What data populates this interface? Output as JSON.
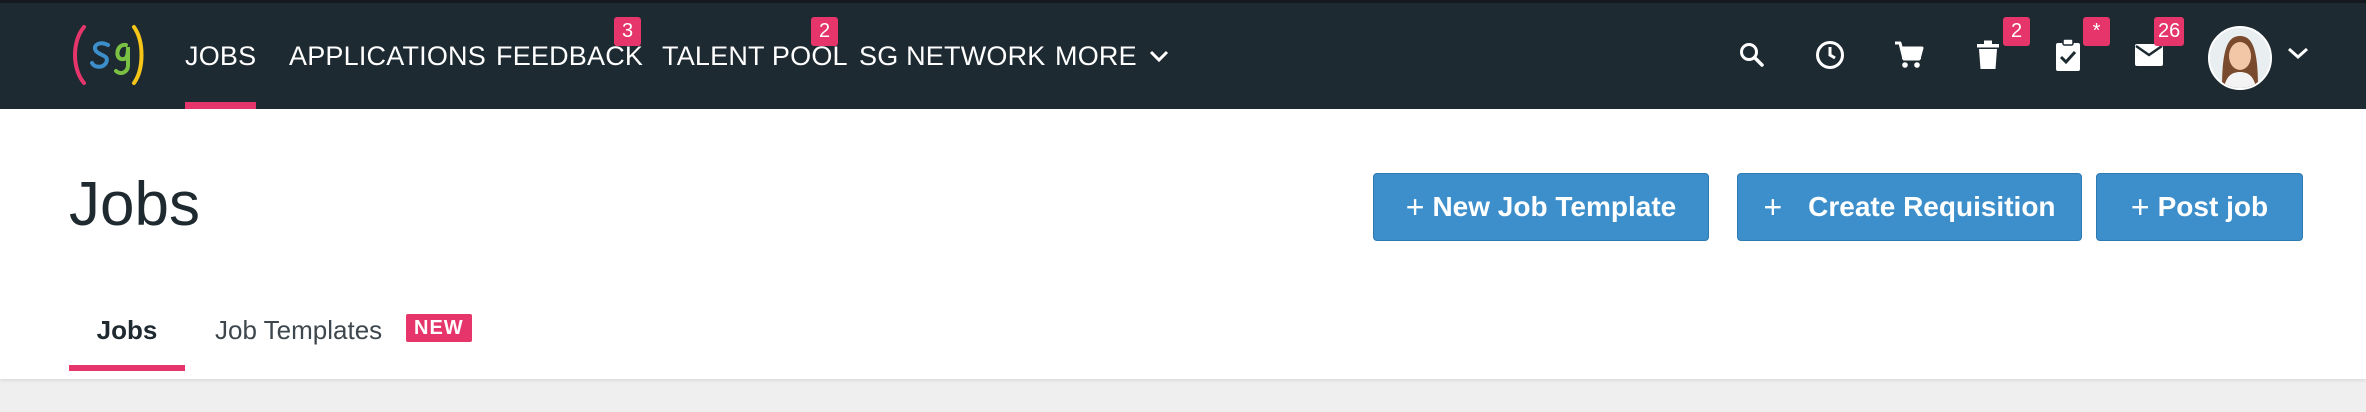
{
  "nav": {
    "items": [
      {
        "label": "JOBS"
      },
      {
        "label": "APPLICATIONS"
      },
      {
        "label": "FEEDBACK",
        "badge": "3"
      },
      {
        "label": "TALENT POOL",
        "badge": "2"
      },
      {
        "label": "SG NETWORK"
      },
      {
        "label": "MORE"
      }
    ],
    "active": "JOBS"
  },
  "toolbar": {
    "icons": [
      "search-icon",
      "history-icon",
      "cart-icon",
      "trash-icon",
      "clipboard-check-icon",
      "mail-icon"
    ],
    "trash_badge": "2",
    "tasks_badge": "*",
    "mail_badge": "26"
  },
  "page": {
    "title": "Jobs",
    "buttons": {
      "new_template": "New Job Template",
      "create_requisition": "Create Requisition",
      "post_job": "Post job",
      "plus": "+"
    },
    "tabs": [
      {
        "label": "Jobs",
        "active": true
      },
      {
        "label": "Job Templates",
        "active": false
      }
    ],
    "new_badge": "NEW"
  },
  "colors": {
    "topbar": "#1e2a32",
    "accent": "#e6356b",
    "button": "#3d8fcb"
  }
}
